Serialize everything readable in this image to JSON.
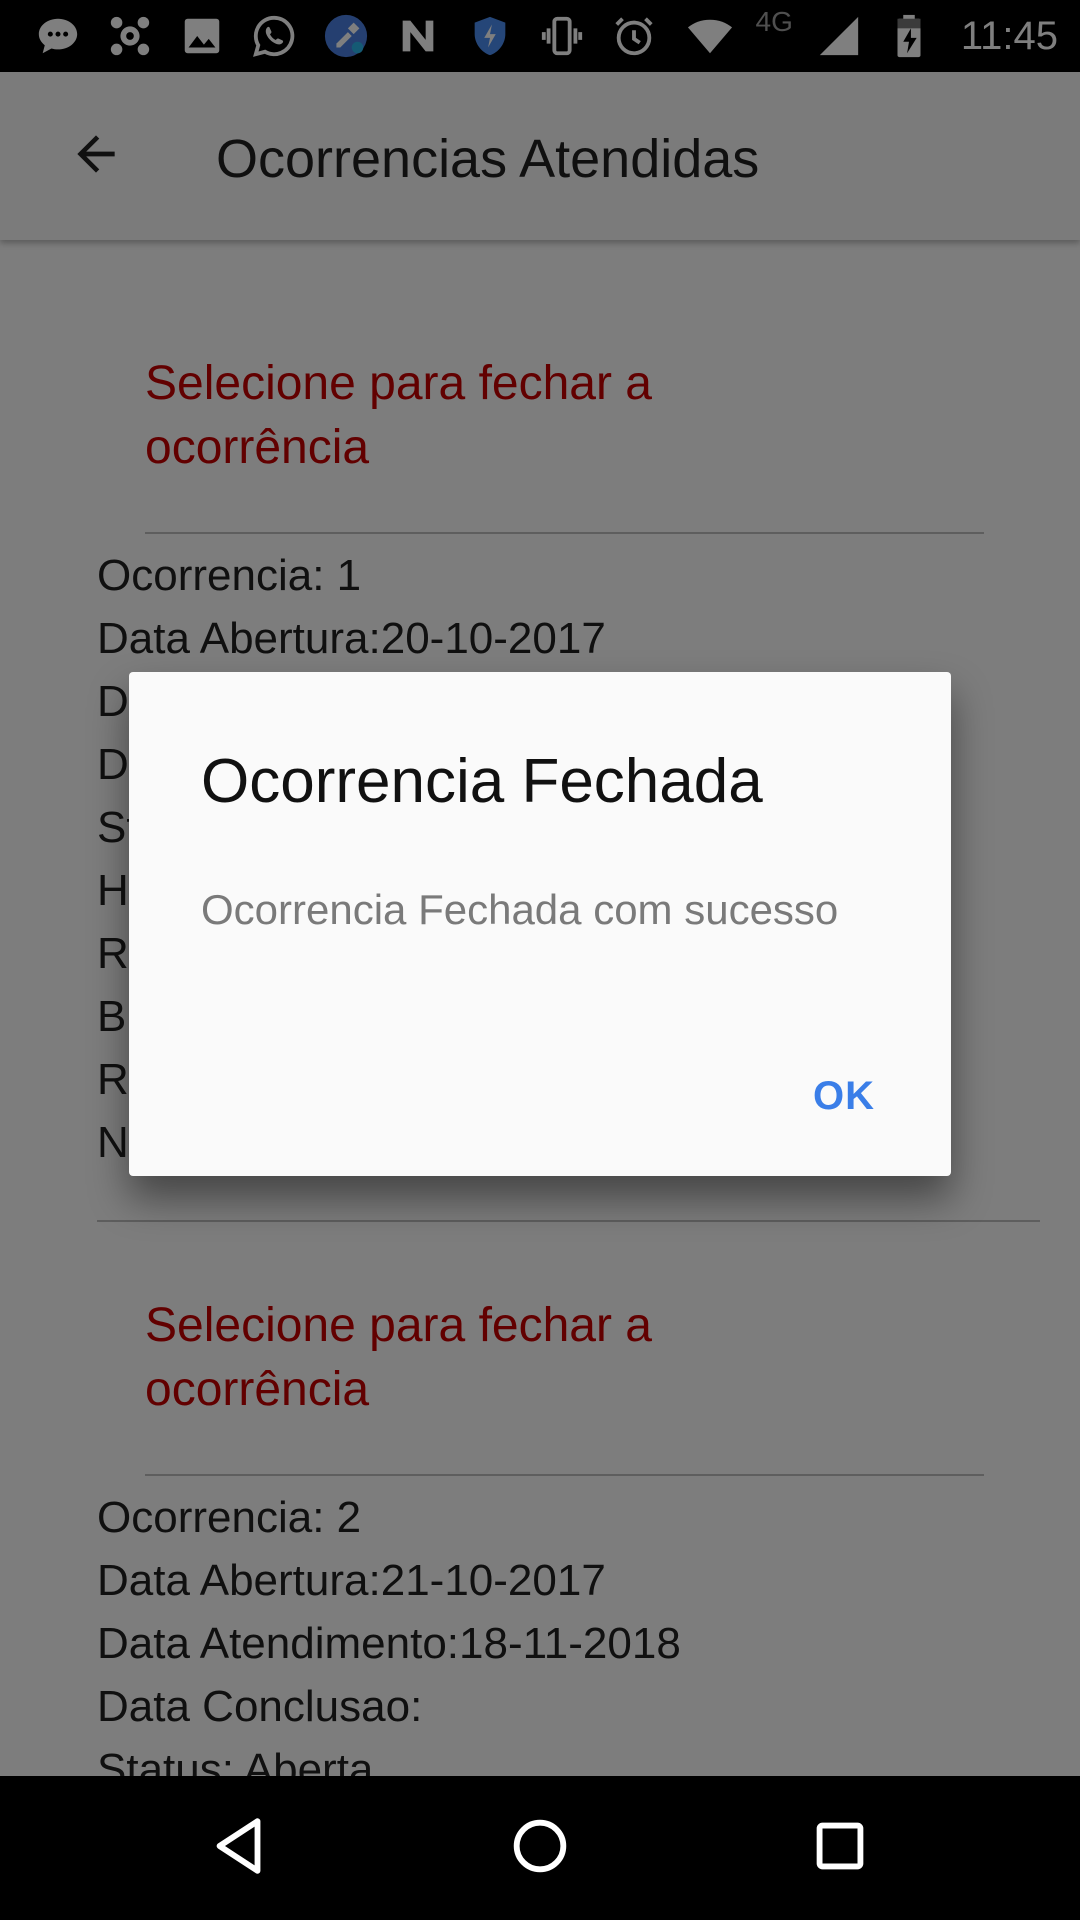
{
  "status_bar": {
    "time": "11:45",
    "network_label": "4G",
    "icons": [
      "messages-icon",
      "avast-icon",
      "gallery-icon",
      "whatsapp-icon",
      "cleaner-icon",
      "n-app-icon",
      "shield-icon",
      "vibrate-icon",
      "alarm-icon",
      "wifi-icon",
      "signal-icon",
      "battery-charging-icon"
    ]
  },
  "app_bar": {
    "back_icon": "arrow-back-icon",
    "title": "Ocorrencias Atendidas"
  },
  "list": {
    "items": [
      {
        "select_label": "Selecione para fechar a ocorrência",
        "lines": [
          "Ocorrencia: 1",
          "Data Abertura:20-10-2017",
          "D",
          "D",
          "St",
          "H",
          "R",
          "B",
          "R",
          "N"
        ]
      },
      {
        "select_label": "Selecione para fechar a ocorrência",
        "lines": [
          "Ocorrencia: 2",
          "Data Abertura:21-10-2017",
          "Data Atendimento:18-11-2018",
          "Data Conclusao:",
          "Status: Aberta"
        ]
      }
    ]
  },
  "dialog": {
    "title": "Ocorrencia Fechada",
    "message": "Ocorrencia Fechada com sucesso",
    "ok_label": "OK"
  },
  "nav_bar": {
    "icons": [
      "nav-back-icon",
      "nav-home-icon",
      "nav-recents-icon"
    ]
  },
  "colors": {
    "select_link": "#c40000",
    "dialog_button": "#3a7ee8",
    "status_bar_bg": "#000000",
    "nav_bar_bg": "#000000"
  }
}
